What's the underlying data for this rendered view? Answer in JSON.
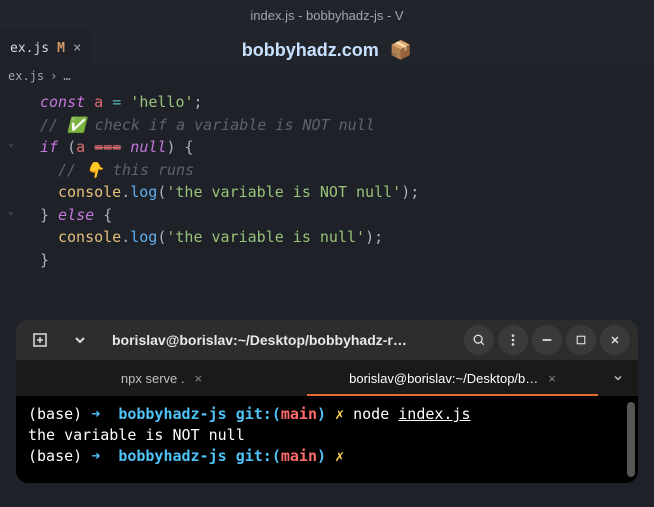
{
  "titlebar": "index.js - bobbyhadz-js - V",
  "watermark": {
    "text": "bobbyhadz.com",
    "icon": "📦"
  },
  "editor_tab": {
    "label": "ex.js",
    "modified": "M",
    "close": "×"
  },
  "breadcrumb": {
    "file": "ex.js",
    "sep": "›",
    "more": "…"
  },
  "code": {
    "l1": {
      "kw": "const",
      "var": " a ",
      "op": "=",
      "str": " 'hello'",
      "punc": ";"
    },
    "l2": {
      "cmt": "// ✅ check if a variable is NOT null"
    },
    "l3": {
      "kw": "if",
      "p1": " (",
      "var": "a ",
      "strike": "===",
      "kw2": " null",
      "p2": ") {"
    },
    "l4": {
      "cmt": "// 👇 this runs"
    },
    "l5": {
      "obj": "console",
      "dot": ".",
      "fn": "log",
      "p1": "(",
      "str": "'the variable is NOT null'",
      "p2": ");"
    },
    "l6": {
      "p1": "}",
      "kw": " else ",
      "p2": "{"
    },
    "l7": {
      "obj": "console",
      "dot": ".",
      "fn": "log",
      "p1": "(",
      "str": "'the variable is null'",
      "p2": ");"
    },
    "l8": {
      "p": "}"
    }
  },
  "terminal": {
    "title": "borislav@borislav:~/Desktop/bobbyhadz-r…",
    "tabs": {
      "t1": "npx serve .",
      "t2": "borislav@borislav:~/Desktop/b…"
    },
    "output": {
      "l1": {
        "base": "(base) ",
        "arrow": "➜  ",
        "dir": "bobbyhadz-js ",
        "git": "git:",
        "po": "(",
        "branch": "main",
        "pc": ") ",
        "x": "✗ ",
        "cmd": "node ",
        "arg": "index.js"
      },
      "l2": "the variable is NOT null",
      "l3": {
        "base": "(base) ",
        "arrow": "➜  ",
        "dir": "bobbyhadz-js ",
        "git": "git:",
        "po": "(",
        "branch": "main",
        "pc": ") ",
        "x": "✗ "
      }
    }
  }
}
